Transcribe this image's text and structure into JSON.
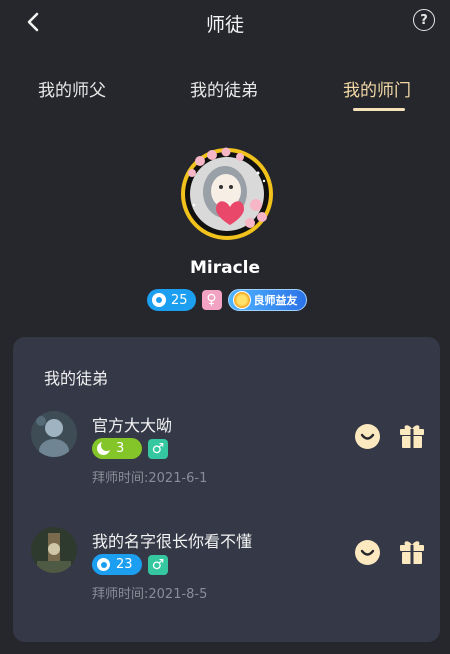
{
  "header": {
    "title": "师徒",
    "back_icon": "chevron-left-icon",
    "help_icon": "question-circle-icon",
    "help_label": "?"
  },
  "tabs": [
    {
      "label": "我的师父",
      "active": false
    },
    {
      "label": "我的徒弟",
      "active": false
    },
    {
      "label": "我的师门",
      "active": true
    }
  ],
  "colors": {
    "background": "#26272c",
    "card": "#353847",
    "active_tab": "#f2d9a6",
    "level_blue": "#1c9ff0",
    "level_green": "#84c52a",
    "female": "#f2a3c1",
    "male": "#35c79f",
    "action_icon": "#fde9bf"
  },
  "profile": {
    "name": "Miracle",
    "level": "25",
    "gender_symbol": "♀",
    "honor_badge": "良师益友"
  },
  "section": {
    "title": "我的徒弟",
    "apprentices": [
      {
        "name": "官方大大呦",
        "level": "3",
        "level_icon": "moon-icon",
        "gender_symbol": "♂",
        "date": "拜师时间:2021-6-1",
        "actions": [
          "smile-icon",
          "gift-icon"
        ]
      },
      {
        "name": "我的名字很长你看不懂",
        "level": "23",
        "level_icon": "gear-icon",
        "gender_symbol": "♂",
        "date": "拜师时间:2021-8-5",
        "actions": [
          "smile-icon",
          "gift-icon"
        ]
      }
    ]
  }
}
